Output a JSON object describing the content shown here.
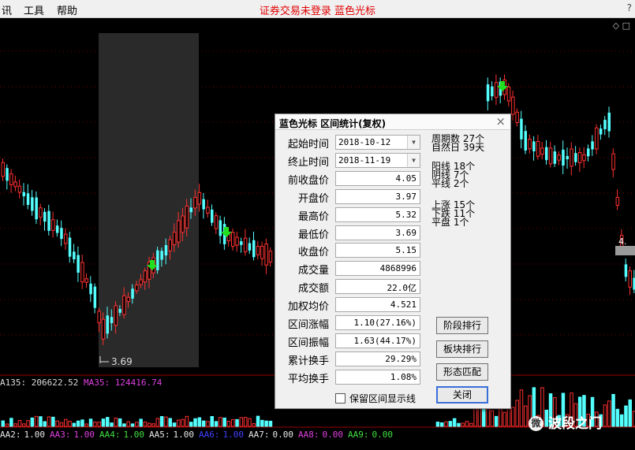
{
  "menu": {
    "items": [
      "讯",
      "工具",
      "帮助"
    ],
    "center": "证券交易未登录  蓝色光标",
    "help": "?"
  },
  "chart_labels": {
    "low_price": "3.69",
    "right_price": "4."
  },
  "dialog": {
    "title": "蓝色光标 区间统计(复权)",
    "close": "×",
    "fields": [
      {
        "label": "起始时间",
        "value": "2018-10-12",
        "combo": true
      },
      {
        "label": "终止时间",
        "value": "2018-11-19",
        "combo": true
      },
      {
        "label": "前收盘价",
        "value": "4.05"
      },
      {
        "label": "开盘价",
        "value": "3.97"
      },
      {
        "label": "最高价",
        "value": "5.32"
      },
      {
        "label": "最低价",
        "value": "3.69"
      },
      {
        "label": "收盘价",
        "value": "5.15"
      },
      {
        "label": "成交量",
        "value": "4868996"
      },
      {
        "label": "成交额",
        "value": "22.0亿"
      },
      {
        "label": "加权均价",
        "value": "4.521"
      },
      {
        "label": "区间涨幅",
        "value": "1.10(27.16%)"
      },
      {
        "label": "区间振幅",
        "value": "1.63(44.17%)"
      },
      {
        "label": "累计换手",
        "value": "29.29%"
      },
      {
        "label": "平均换手",
        "value": "1.08%"
      }
    ],
    "stats": [
      [
        "周期数 27个",
        "自然日 39天"
      ],
      [
        "阳线 18个",
        "阴线 7个",
        "平线 2个"
      ],
      [
        "上涨 15个",
        "下跌 11个",
        "平盘 1个"
      ]
    ],
    "buttons": [
      "阶段排行",
      "板块排行",
      "形态匹配",
      "关闭"
    ],
    "checkbox": "保留区间显示线"
  },
  "volume_label": {
    "name": "A135:",
    "value": "206622.52",
    "ma_name": "MA35:",
    "ma_value": "124416.74"
  },
  "ma_items": [
    {
      "label": "AA2:",
      "value": "1.00",
      "color": "#e8e8e8"
    },
    {
      "label": "AA3:",
      "value": "1.00",
      "color": "#e040e0"
    },
    {
      "label": "AA4:",
      "value": "1.00",
      "color": "#40e040"
    },
    {
      "label": "AA5:",
      "value": "1.00",
      "color": "#e8e8e8"
    },
    {
      "label": "AA6:",
      "value": "1.00",
      "color": "#4040ff"
    },
    {
      "label": "AA7:",
      "value": "0.00",
      "color": "#e8e8e8"
    },
    {
      "label": "AA8:",
      "value": "0.00",
      "color": "#e040e0"
    },
    {
      "label": "AA9:",
      "value": "0.00",
      "color": "#40e040"
    }
  ],
  "watermark": {
    "icon": "微",
    "text": "波段之门"
  },
  "colors": {
    "up": "#ff3030",
    "down": "#54ffff",
    "grid": "#7a0000",
    "selection": "#2a2a2a"
  }
}
